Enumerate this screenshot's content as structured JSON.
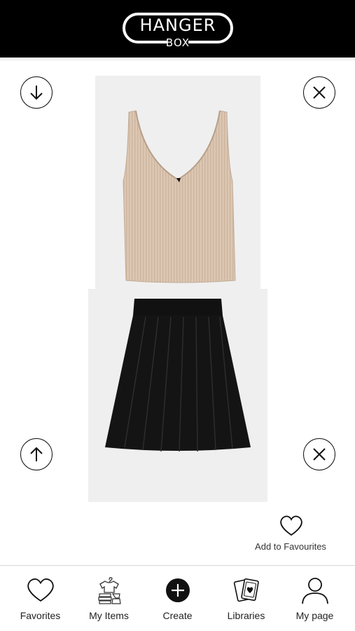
{
  "app": {
    "logo_line1": "HANGER",
    "logo_line2": "BOX"
  },
  "outfit": {
    "top_item": "beige-ribbed-v-neck-tank-top",
    "bottom_item": "black-pleated-skirt"
  },
  "actions": {
    "favourite_label": "Add to Favourites"
  },
  "tabs": [
    {
      "label": "Favorites",
      "icon": "heart-icon"
    },
    {
      "label": "My Items",
      "icon": "clothes-stack-icon"
    },
    {
      "label": "Create",
      "icon": "plus-circle-icon"
    },
    {
      "label": "Libraries",
      "icon": "cards-icon"
    },
    {
      "label": "My page",
      "icon": "user-icon"
    }
  ]
}
